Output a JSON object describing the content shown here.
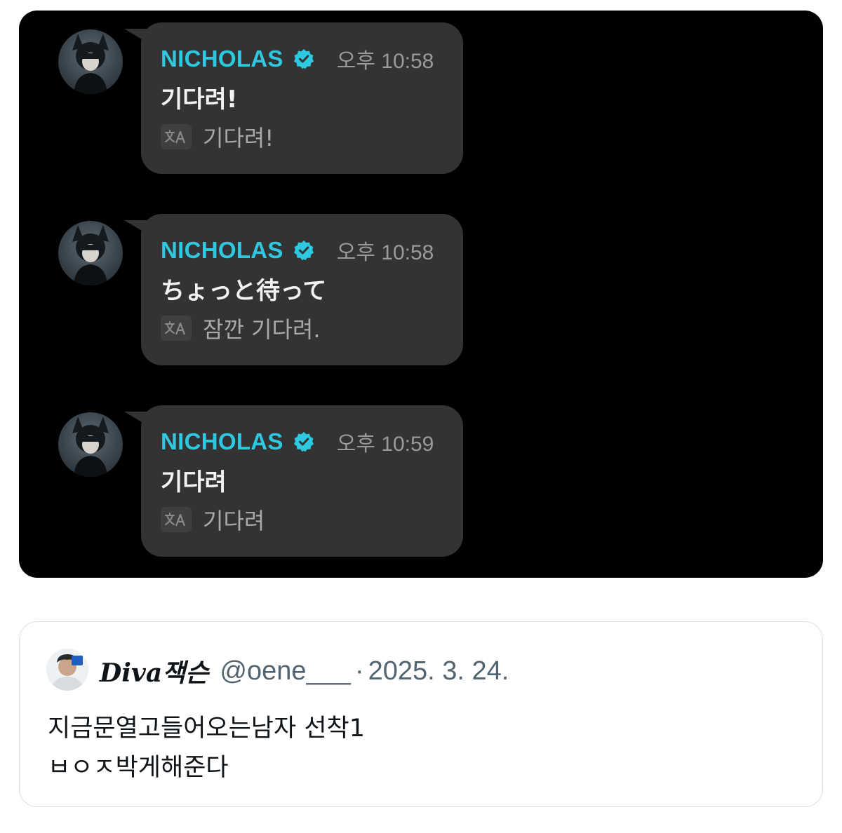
{
  "chat": {
    "messages": [
      {
        "sender": "NICHOLAS",
        "verified_icon": "verified-badge-icon",
        "time": "오후 10:58",
        "text": "기다려!",
        "translate_icon": "translate-icon",
        "translation": "기다려!"
      },
      {
        "sender": "NICHOLAS",
        "verified_icon": "verified-badge-icon",
        "time": "오후 10:58",
        "text": "ちょっと待って",
        "translate_icon": "translate-icon",
        "translation": "잠깐 기다려."
      },
      {
        "sender": "NICHOLAS",
        "verified_icon": "verified-badge-icon",
        "time": "오후 10:59",
        "text": "기다려",
        "translate_icon": "translate-icon",
        "translation": "기다려"
      }
    ],
    "colors": {
      "background": "#000000",
      "bubble": "#333333",
      "sender": "#2ec8e0",
      "time": "#9a9a9a"
    }
  },
  "quote_tweet": {
    "display_name": "Diva잭슨",
    "handle": "@oene___",
    "separator": "·",
    "date": "2025. 3. 24.",
    "body_lines": [
      "지금문열고들어오는남자 선착1",
      "ㅂㅇㅈ박게해준다"
    ]
  }
}
